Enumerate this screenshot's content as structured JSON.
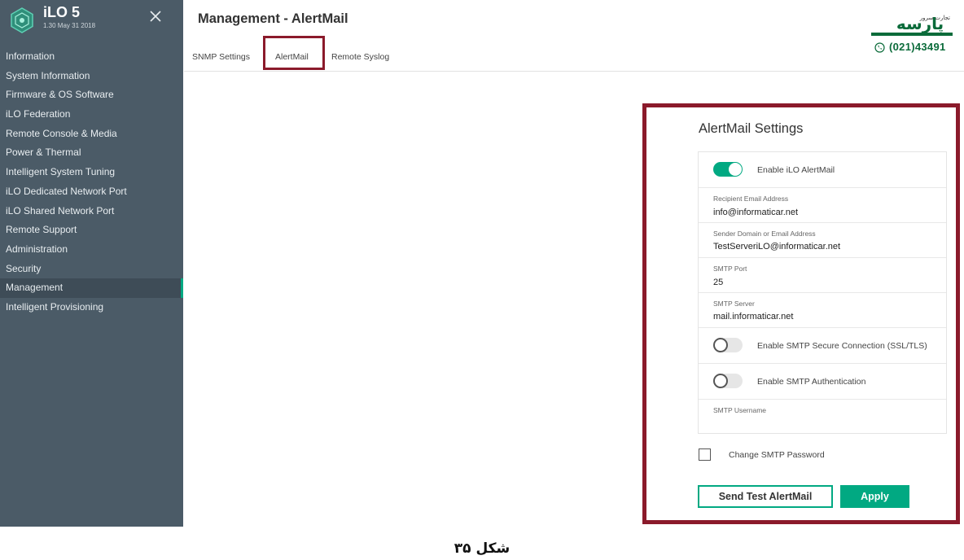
{
  "app": {
    "name": "iLO 5",
    "version": "1.30 May 31 2018"
  },
  "sidebar": {
    "items": [
      {
        "label": "Information"
      },
      {
        "label": "System Information"
      },
      {
        "label": "Firmware & OS Software"
      },
      {
        "label": "iLO Federation"
      },
      {
        "label": "Remote Console & Media"
      },
      {
        "label": "Power & Thermal"
      },
      {
        "label": "Intelligent System Tuning"
      },
      {
        "label": "iLO Dedicated Network Port"
      },
      {
        "label": "iLO Shared Network Port"
      },
      {
        "label": "Remote Support"
      },
      {
        "label": "Administration"
      },
      {
        "label": "Security"
      },
      {
        "label": "Management",
        "active": true
      },
      {
        "label": "Intelligent Provisioning"
      }
    ]
  },
  "header": {
    "title": "Management - AlertMail"
  },
  "tabs": [
    {
      "label": "SNMP Settings"
    },
    {
      "label": "AlertMail",
      "selected": true
    },
    {
      "label": "Remote Syslog"
    }
  ],
  "watermark": {
    "brand_text": "پارسه",
    "sub_text": "تجارت سرور",
    "phone": "(021)43491"
  },
  "alertmail": {
    "title": "AlertMail Settings",
    "enable_alertmail": {
      "label": "Enable iLO AlertMail",
      "on": true
    },
    "recipient": {
      "label": "Recipient Email Address",
      "value": "info@informaticar.net"
    },
    "sender": {
      "label": "Sender Domain or Email Address",
      "value": "TestServeriLO@informaticar.net"
    },
    "smtp_port": {
      "label": "SMTP Port",
      "value": "25"
    },
    "smtp_server": {
      "label": "SMTP Server",
      "value": "mail.informaticar.net"
    },
    "secure_connection": {
      "label": "Enable SMTP Secure Connection (SSL/TLS)",
      "on": false
    },
    "smtp_auth": {
      "label": "Enable SMTP Authentication",
      "on": false
    },
    "smtp_username": {
      "label": "SMTP Username",
      "value": ""
    },
    "change_password": {
      "label": "Change SMTP Password",
      "checked": false
    },
    "send_test_label": "Send Test AlertMail",
    "apply_label": "Apply"
  },
  "caption": "شکل ۳۵",
  "colors": {
    "accent": "#01a982",
    "sidebar": "#4b5b67",
    "highlight_frame": "#8b1a2b"
  }
}
